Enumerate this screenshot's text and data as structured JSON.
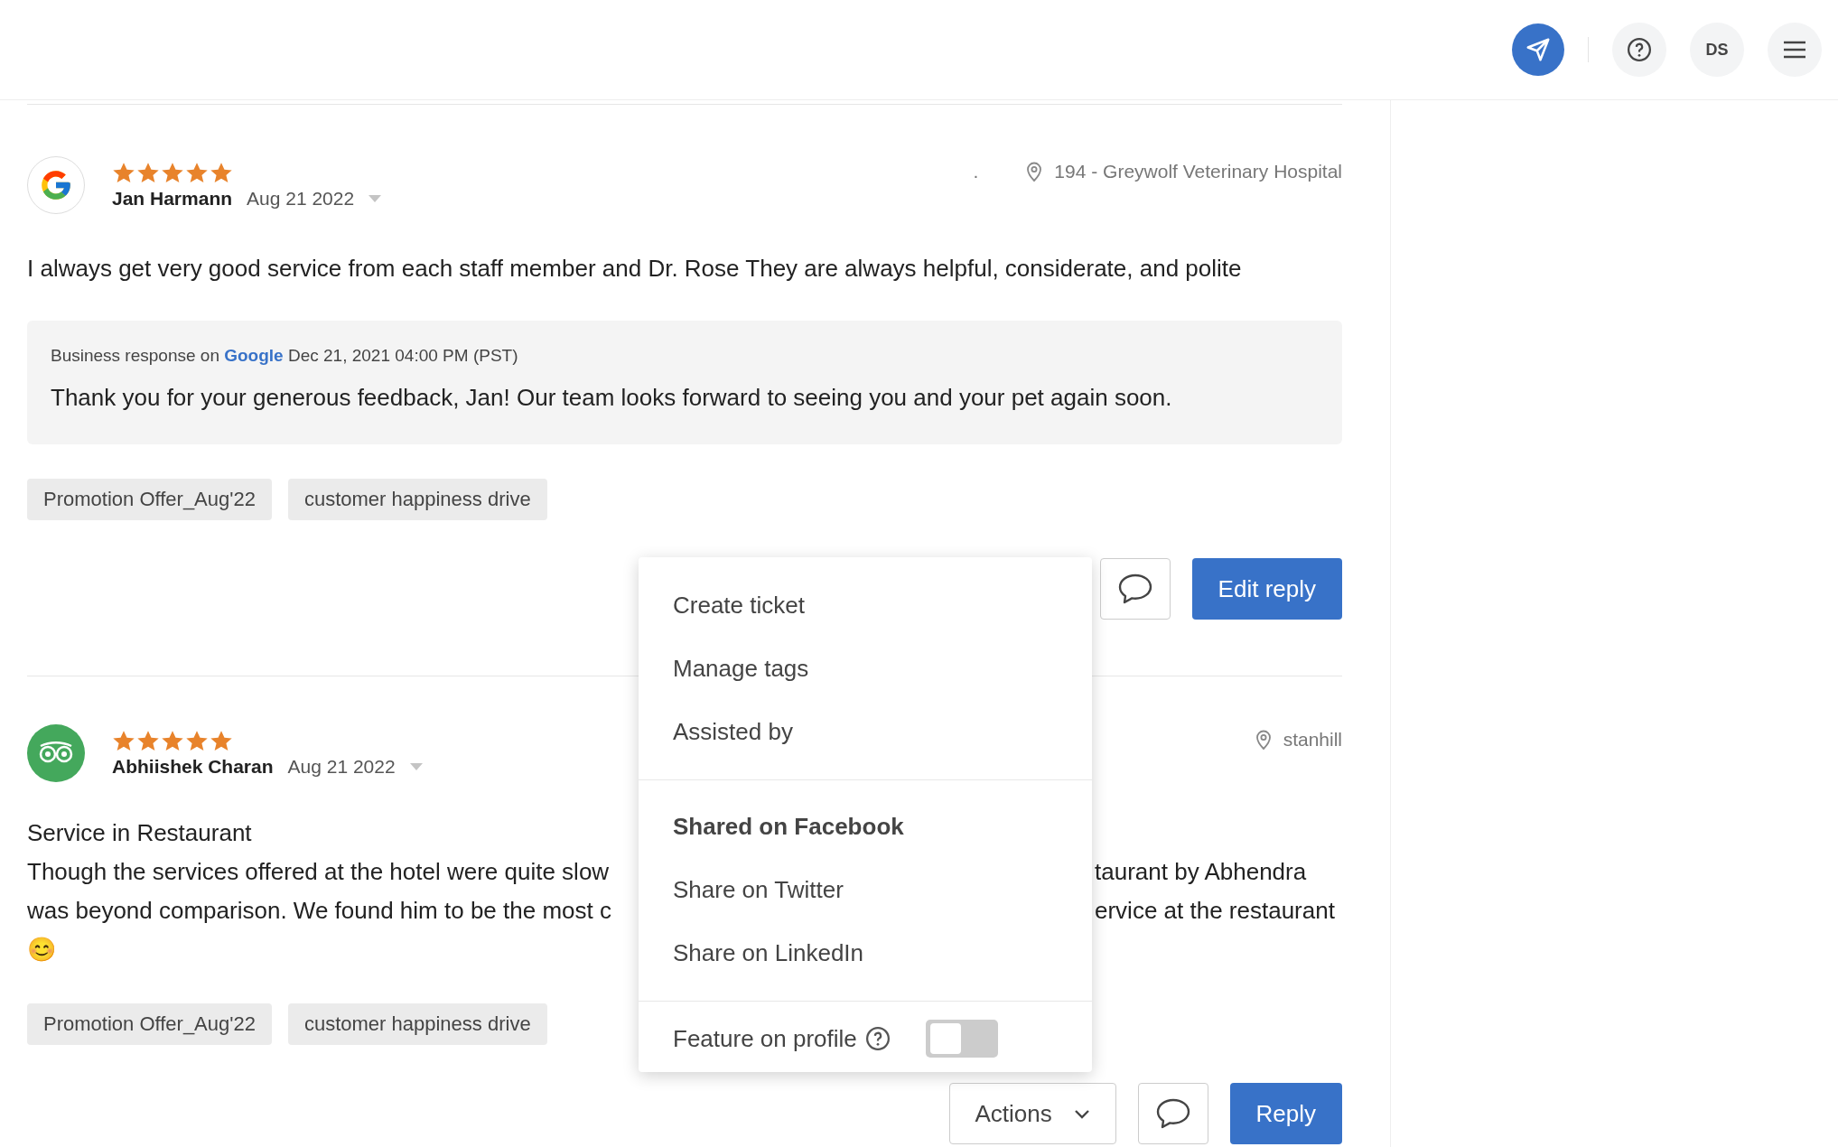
{
  "header": {
    "user_initials": "DS"
  },
  "reviews": [
    {
      "kind": "google",
      "stars": 5,
      "author": "Jan Harmann",
      "date": "Aug 21 2022",
      "location_prefix": ".",
      "location": "194 - Greywolf Veterinary Hospital",
      "lines": [
        [
          "I always get very good service from each staff member and Dr. Rose They are always helpful, considerate, and polite"
        ]
      ],
      "response": {
        "prefix": "Business response on",
        "platform": "Google",
        "date": "Dec 21, 2021 04:00 PM (PST)",
        "text": "Thank you for your generous feedback, Jan! Our team looks forward to seeing you and your pet again soon."
      },
      "tags": [
        "Promotion Offer_Aug'22",
        "customer happiness drive"
      ],
      "reply_label": "Edit reply"
    },
    {
      "kind": "tripadvisor",
      "stars": 5,
      "author": "Abhiishek Charan",
      "date": "Aug 21 2022",
      "location": "stanhill",
      "title": "Service in Restaurant",
      "lines": [
        [
          "Though the services offered at the hotel were quite slow",
          "taurant by Abhendra"
        ],
        [
          "was beyond comparison. We found him to be the most c",
          "ervice at the restaurant"
        ],
        [
          "😊"
        ]
      ],
      "tags": [
        "Promotion Offer_Aug'22",
        "customer happiness drive"
      ],
      "actions_label": "Actions",
      "reply_label": "Reply"
    }
  ],
  "menu": {
    "groups": [
      [
        {
          "label": "Create ticket",
          "active": false
        },
        {
          "label": "Manage tags",
          "active": false
        },
        {
          "label": "Assisted by",
          "active": false
        }
      ],
      [
        {
          "label": "Shared on Facebook",
          "active": true
        },
        {
          "label": "Share on Twitter",
          "active": false
        },
        {
          "label": "Share on LinkedIn",
          "active": false
        }
      ]
    ],
    "feature": {
      "label": "Feature on profile",
      "on": false
    }
  }
}
